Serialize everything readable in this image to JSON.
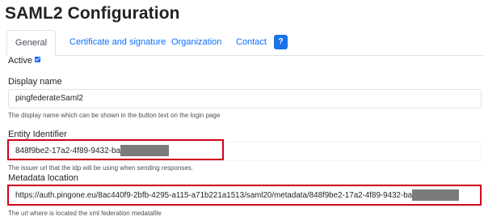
{
  "page": {
    "title": "SAML2 Configuration"
  },
  "tabs": [
    {
      "label": "General",
      "active": true
    },
    {
      "label": "Certificate and signature"
    },
    {
      "label": "Organization"
    },
    {
      "label": "Contact"
    }
  ],
  "help_button": {
    "label": "?"
  },
  "form": {
    "active": {
      "label": "Active",
      "checked": true
    },
    "display_name": {
      "label": "Display name",
      "value": "pingfederateSaml2",
      "help": "The display name which can be shown in the button text on the login page"
    },
    "entity_identifier": {
      "label": "Entity Identifier",
      "value": "848f9be2-17a2-4f89-9432-ba",
      "help": "The issuer url that the idp will be using when sending responses."
    },
    "metadata_location": {
      "label": "Metadata location",
      "value": "https://auth.pingone.eu/8ac440f9-2bfb-4295-a115-a71b221a1513/saml20/metadata/848f9be2-17a2-4f89-9432-ba",
      "help": "The url where is located the xml federation medatafile"
    }
  },
  "colors": {
    "accent": "#0d6efd",
    "highlight": "#d0021b",
    "redaction": "#7b7b7b"
  }
}
